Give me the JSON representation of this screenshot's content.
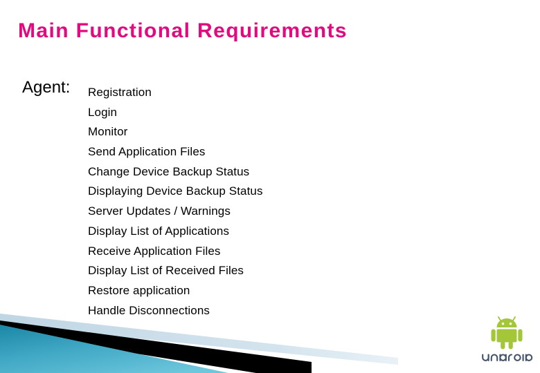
{
  "slide": {
    "title": "Main Functional Requirements",
    "section_label": "Agent:",
    "requirements": [
      "Registration",
      "Login",
      "Monitor",
      "Send Application Files",
      "Change Device Backup Status",
      "Displaying Device Backup Status",
      "Server Updates / Warnings",
      "Display List of Applications",
      "Receive Application Files",
      "Display List of Received Files",
      "Restore application",
      "Handle Disconnections"
    ]
  },
  "branding": {
    "logo_wordmark": "android",
    "logo_alt": "android-robot-logo"
  },
  "colors": {
    "title": "#E10A7E",
    "body_text": "#000000",
    "background": "#FFFFFF",
    "band_teal_dark": "#1A87A8",
    "band_teal_light": "#63BFD8",
    "band_black": "#000000",
    "band_pale_blue": "#C6DCE8",
    "android_green": "#A4C639",
    "android_wordmark": "#43536B"
  }
}
